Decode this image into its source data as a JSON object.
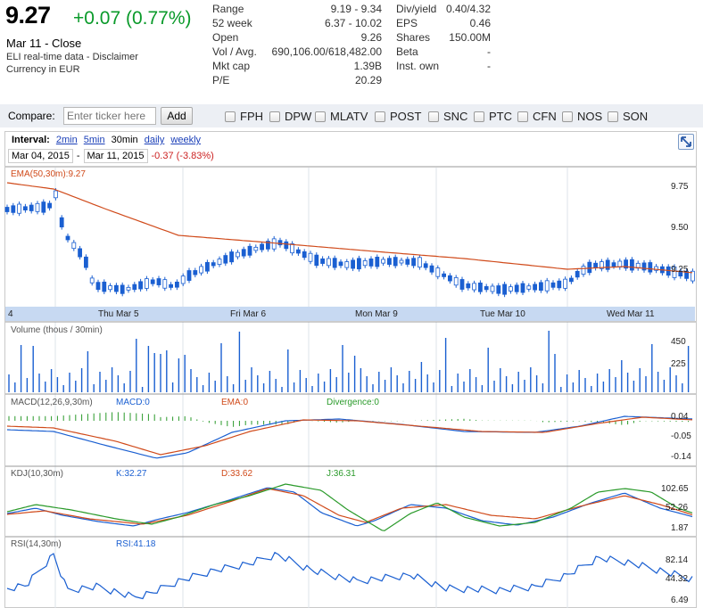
{
  "quote": {
    "price": "9.27",
    "change": "+0.07 (0.77%)",
    "close_label": "Mar 11 - Close",
    "source_line": "ELI real-time data - Disclaimer",
    "currency": "Currency in EUR"
  },
  "stats_left": [
    {
      "label": "Range",
      "value": "9.19 - 9.34"
    },
    {
      "label": "52 week",
      "value": "6.37 - 10.02"
    },
    {
      "label": "Open",
      "value": "9.26"
    },
    {
      "label": "Vol / Avg.",
      "value": "690,106.00/618,482.00"
    },
    {
      "label": "Mkt cap",
      "value": "1.39B"
    },
    {
      "label": "P/E",
      "value": "20.29"
    }
  ],
  "stats_right": [
    {
      "label": "Div/yield",
      "value": "0.40/4.32"
    },
    {
      "label": "EPS",
      "value": "0.46"
    },
    {
      "label": "Shares",
      "value": "150.00M"
    },
    {
      "label": "Beta",
      "value": "-"
    },
    {
      "label": "Inst. own",
      "value": "-"
    }
  ],
  "compare": {
    "label": "Compare:",
    "placeholder": "Enter ticker here",
    "add_label": "Add",
    "tickers": [
      "FPH",
      "DPW",
      "MLATV",
      "POST",
      "SNC",
      "PTC",
      "CFN",
      "NOS",
      "SON"
    ]
  },
  "interval": {
    "label": "Interval:",
    "options": [
      "2min",
      "5min",
      "30min",
      "daily",
      "weekly"
    ],
    "selected": "30min"
  },
  "range": {
    "start": "Mar 04, 2015",
    "sep": "-",
    "end": "Mar 11, 2015",
    "change": "-0.37 (-3.83%)"
  },
  "colors": {
    "up": "#1a5fd1",
    "ema": "#d04a1a",
    "green": "#2a9a2a",
    "axisbar": "#c7d9f2"
  },
  "main_chart": {
    "label": "EMA(50,30m):9.27",
    "y_ticks": [
      "9.75",
      "9.50",
      "9.25"
    ],
    "x_labels": [
      "4",
      "Thu Mar 5",
      "Fri Mar 6",
      "Mon Mar 9",
      "Tue Mar 10",
      "Wed Mar 11"
    ]
  },
  "volume": {
    "label": "Volume (thous / 30min)",
    "y_ticks": [
      "450",
      "225"
    ]
  },
  "macd": {
    "label": "MACD(12,26,9,30m)",
    "macd": "MACD:0",
    "ema": "EMA:0",
    "divergence": "Divergence:0",
    "y_ticks": [
      "0.04",
      "-0.05",
      "-0.14"
    ]
  },
  "kdj": {
    "label": "KDJ(10,30m)",
    "k": "K:32.27",
    "d": "D:33.62",
    "j": "J:36.31",
    "y_ticks": [
      "102.65",
      "52.26",
      "1.87"
    ]
  },
  "rsi": {
    "label": "RSI(14,30m)",
    "rsi": "RSI:41.18",
    "y_ticks": [
      "82.14",
      "44.32",
      "6.49"
    ]
  }
}
